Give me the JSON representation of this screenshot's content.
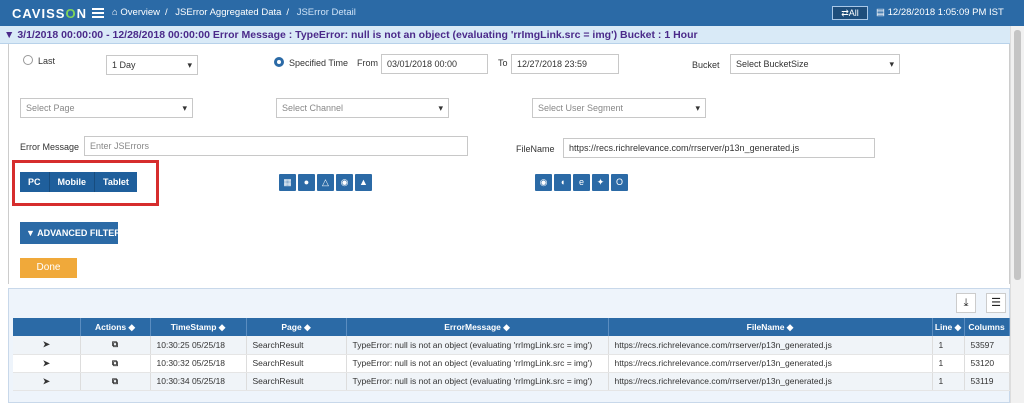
{
  "header": {
    "logo_prefix": "CAVISS",
    "logo_o": "O",
    "logo_suffix": "N",
    "breadcrumb": [
      "Overview",
      "JSError Aggregated Data",
      "JSError Detail"
    ],
    "all_label": "All",
    "datetime": "12/28/2018 1:05:09 PM IST"
  },
  "title": "3/1/2018 00:00:00 - 12/28/2018 00:00:00 Error Message : TypeError: null is not an object (evaluating 'rrImgLink.src = img') Bucket : 1 Hour",
  "filters": {
    "last_label": "Last",
    "last_value": "1 Day",
    "specified_label": "Specified Time",
    "from_label": "From",
    "from_value": "03/01/2018 00:00",
    "to_label": "To",
    "to_value": "12/27/2018 23:59",
    "bucket_label": "Bucket",
    "bucket_value": "Select BucketSize",
    "page_placeholder": "Select Page",
    "channel_placeholder": "Select Channel",
    "segment_placeholder": "Select User Segment",
    "error_message_label": "Error Message",
    "error_message_placeholder": "Enter JSErrors",
    "filename_label": "FileName",
    "filename_value": "https://recs.richrelevance.com/rrserver/p13n_generated.js",
    "devices": [
      "PC",
      "Mobile",
      "Tablet"
    ],
    "os_icons": [
      "windows-icon",
      "apple-icon",
      "linux-icon",
      "chrome-os-icon",
      "android-icon"
    ],
    "browser_icons": [
      "chrome-icon",
      "firefox-icon",
      "ie-icon",
      "safari-icon",
      "opera-icon"
    ],
    "advanced_filter_label": "ADVANCED FILTER",
    "done_label": "Done"
  },
  "table": {
    "columns": [
      "",
      "Actions ◆",
      "TimeStamp ◆",
      "Page ◆",
      "ErrorMessage ◆",
      "FileName ◆",
      "Line ◆",
      "Columns"
    ],
    "rows": [
      [
        "10:30:25 05/25/18",
        "SearchResult",
        "TypeError: null is not an object (evaluating 'rrImgLink.src = img')",
        "https://recs.richrelevance.com/rrserver/p13n_generated.js",
        "1",
        "53597"
      ],
      [
        "10:30:32 05/25/18",
        "SearchResult",
        "TypeError: null is not an object (evaluating 'rrImgLink.src = img')",
        "https://recs.richrelevance.com/rrserver/p13n_generated.js",
        "1",
        "53120"
      ],
      [
        "10:30:34 05/25/18",
        "SearchResult",
        "TypeError: null is not an object (evaluating 'rrImgLink.src = img')",
        "https://recs.richrelevance.com/rrserver/p13n_generated.js",
        "1",
        "53119"
      ]
    ]
  },
  "colors": {
    "primary": "#2b6aa6",
    "highlight": "#d62d2d",
    "done": "#f0a93a",
    "title": "#4b2a8a"
  }
}
